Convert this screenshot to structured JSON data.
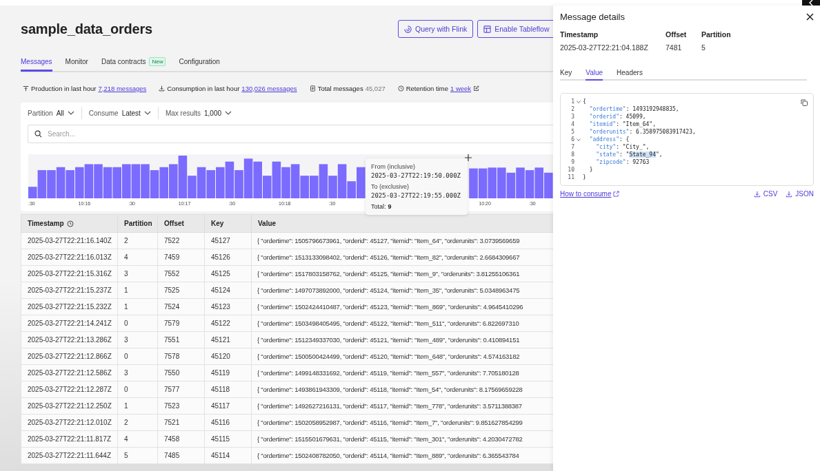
{
  "page": {
    "title": "sample_data_orders",
    "actions": [
      {
        "label": "Query with Flink",
        "kind": "flink"
      },
      {
        "label": "Enable Tableflow",
        "kind": "table"
      }
    ]
  },
  "tabs": [
    {
      "label": "Messages",
      "selected": true
    },
    {
      "label": "Monitor",
      "selected": false
    },
    {
      "label": "Data contracts",
      "selected": false,
      "badge": "New"
    },
    {
      "label": "Configuration",
      "selected": false
    }
  ],
  "stats": [
    {
      "kind": "upload",
      "label": "Production in last hour",
      "link": "7,218 messages"
    },
    {
      "kind": "download",
      "label": "Consumption in last hour",
      "link": "130,026 messages"
    },
    {
      "kind": "doc",
      "label": "Total messages",
      "value": "45,027"
    },
    {
      "kind": "clock",
      "label": "Retention time",
      "link": "1 week"
    }
  ],
  "filters": [
    {
      "label": "Partition",
      "value": "All"
    },
    {
      "label": "Consume",
      "value": "Latest"
    },
    {
      "label": "Max results",
      "value": "1,000"
    }
  ],
  "search": {
    "placeholder": "Search..."
  },
  "histogram": {
    "x_labels": [
      ":30",
      "10:16",
      ":30",
      "10:17",
      ":30",
      "10:18",
      ":30",
      "10:20",
      ":30"
    ]
  },
  "tooltip": {
    "from_label": "From (inclusive)",
    "from": "2025-03-27T22:19:50.000Z",
    "to_label": "To (exclusive)",
    "to": "2025-03-27T22:19:55.000Z",
    "total_label": "Total:",
    "total": "9"
  },
  "table": {
    "columns": [
      {
        "label": "Timestamp",
        "kind": "time"
      },
      {
        "label": "Partition",
        "kind": "plain"
      },
      {
        "label": "Offset",
        "kind": "plain"
      },
      {
        "label": "Key",
        "kind": "plain"
      },
      {
        "label": "Value",
        "kind": "plain"
      }
    ],
    "rows": [
      [
        "2025-03-27T22:21:16.140Z",
        "2",
        "7522",
        "45127",
        "{ \"ordertime\": 1505796673961, \"orderid\": 45127, \"itemid\": \"Item_64\", \"orderunits\": 3.0739569659"
      ],
      [
        "2025-03-27T22:21:16.013Z",
        "4",
        "7459",
        "45126",
        "{ \"ordertime\": 1513133098402, \"orderid\": 45126, \"itemid\": \"Item_82\", \"orderunits\": 2.6684309667"
      ],
      [
        "2025-03-27T22:21:15.316Z",
        "3",
        "7552",
        "45125",
        "{ \"ordertime\": 1517803158762, \"orderid\": 45125, \"itemid\": \"Item_9\", \"orderunits\": 3.81255106361"
      ],
      [
        "2025-03-27T22:21:15.237Z",
        "1",
        "7525",
        "45124",
        "{ \"ordertime\": 1497073892000, \"orderid\": 45124, \"itemid\": \"Item_35\", \"orderunits\": 5.0348963475"
      ],
      [
        "2025-03-27T22:21:15.232Z",
        "1",
        "7524",
        "45123",
        "{ \"ordertime\": 1502424410487, \"orderid\": 45123, \"itemid\": \"Item_869\", \"orderunits\": 4.9645410296"
      ],
      [
        "2025-03-27T22:21:14.241Z",
        "0",
        "7579",
        "45122",
        "{ \"ordertime\": 1503498405495, \"orderid\": 45122, \"itemid\": \"Item_511\", \"orderunits\": 6.822697310"
      ],
      [
        "2025-03-27T22:21:13.286Z",
        "3",
        "7551",
        "45121",
        "{ \"ordertime\": 1512349337030, \"orderid\": 45121, \"itemid\": \"Item_489\", \"orderunits\": 0.410894151"
      ],
      [
        "2025-03-27T22:21:12.866Z",
        "0",
        "7578",
        "45120",
        "{ \"ordertime\": 1500500424499, \"orderid\": 45120, \"itemid\": \"Item_648\", \"orderunits\": 4.574163182"
      ],
      [
        "2025-03-27T22:21:12.586Z",
        "3",
        "7550",
        "45119",
        "{ \"ordertime\": 1499148331692, \"orderid\": 45119, \"itemid\": \"Item_557\", \"orderunits\": 7.705180128"
      ],
      [
        "2025-03-27T22:21:12.287Z",
        "0",
        "7577",
        "45118",
        "{ \"ordertime\": 1493861943309, \"orderid\": 45118, \"itemid\": \"Item_54\", \"orderunits\": 8.17569659228"
      ],
      [
        "2025-03-27T22:21:12.250Z",
        "1",
        "7523",
        "45117",
        "{ \"ordertime\": 1492627216131, \"orderid\": 45117, \"itemid\": \"Item_778\", \"orderunits\": 3.5711388387"
      ],
      [
        "2025-03-27T22:21:12.010Z",
        "2",
        "7521",
        "45116",
        "{ \"ordertime\": 1502058952987, \"orderid\": 45116, \"itemid\": \"Item_7\", \"orderunits\": 9.851627854299"
      ],
      [
        "2025-03-27T22:21:11.817Z",
        "4",
        "7458",
        "45115",
        "{ \"ordertime\": 1515501679631, \"orderid\": 45115, \"itemid\": \"Item_301\", \"orderunits\": 4.2030472782"
      ],
      [
        "2025-03-27T22:21:11.644Z",
        "5",
        "7485",
        "45114",
        "{ \"ordertime\": 1502408782050, \"orderid\": 45114, \"itemid\": \"Item_889\", \"orderunits\": 6.365543784"
      ]
    ]
  },
  "details": {
    "title": "Message details",
    "fields": [
      {
        "label": "Timestamp",
        "value": "2025-03-27T22:21:04.188Z"
      },
      {
        "label": "Offset",
        "value": "7481"
      },
      {
        "label": "Partition",
        "value": "5"
      }
    ],
    "tabs": [
      {
        "label": "Key",
        "selected": false
      },
      {
        "label": "Value",
        "selected": true
      },
      {
        "label": "Headers",
        "selected": false
      }
    ],
    "code": [
      {
        "num": "1",
        "fold": true,
        "segments": [
          {
            "kind": "plain",
            "text": "{"
          }
        ]
      },
      {
        "num": "2",
        "fold": false,
        "segments": [
          {
            "kind": "key",
            "text": "  \"ordertime\""
          },
          {
            "kind": "plain",
            "text": ": 1493192948835,"
          }
        ]
      },
      {
        "num": "3",
        "fold": false,
        "segments": [
          {
            "kind": "key",
            "text": "  \"orderid\""
          },
          {
            "kind": "plain",
            "text": ": 45099,"
          }
        ]
      },
      {
        "num": "4",
        "fold": false,
        "segments": [
          {
            "kind": "key",
            "text": "  \"itemid\""
          },
          {
            "kind": "plain",
            "text": ": \"Item_64\","
          }
        ]
      },
      {
        "num": "5",
        "fold": false,
        "segments": [
          {
            "kind": "key",
            "text": "  \"orderunits\""
          },
          {
            "kind": "plain",
            "text": ": 6.358975083917423,"
          }
        ]
      },
      {
        "num": "6",
        "fold": true,
        "segments": [
          {
            "kind": "key",
            "text": "  \"address\""
          },
          {
            "kind": "plain",
            "text": ": {"
          }
        ]
      },
      {
        "num": "7",
        "fold": false,
        "segments": [
          {
            "kind": "key",
            "text": "    \"city\""
          },
          {
            "kind": "plain",
            "text": ": \"City_\","
          }
        ]
      },
      {
        "num": "8",
        "fold": false,
        "segments": [
          {
            "kind": "key",
            "text": "    \"state\""
          },
          {
            "kind": "plain",
            "text": ": \""
          },
          {
            "kind": "selected",
            "text": "State_94"
          },
          {
            "kind": "plain",
            "text": "\","
          }
        ]
      },
      {
        "num": "9",
        "fold": false,
        "segments": [
          {
            "kind": "key",
            "text": "    \"zipcode\""
          },
          {
            "kind": "plain",
            "text": ": 92763"
          }
        ]
      },
      {
        "num": "10",
        "fold": false,
        "segments": [
          {
            "kind": "plain",
            "text": "  }"
          }
        ]
      },
      {
        "num": "11",
        "fold": false,
        "segments": [
          {
            "kind": "plain",
            "text": "}"
          }
        ]
      }
    ],
    "consume_link": "How to consume",
    "downloads": [
      "CSV",
      "JSON"
    ]
  }
}
